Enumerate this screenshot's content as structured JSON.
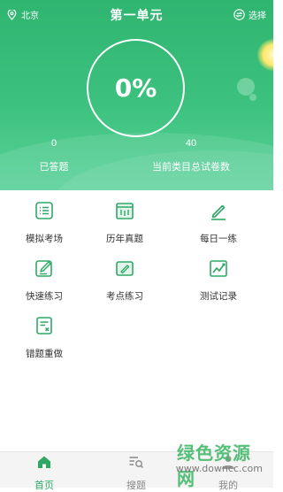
{
  "header": {
    "location": "北京",
    "title": "第一单元",
    "select_label": "选择"
  },
  "progress": {
    "percent_text": "0%",
    "percent_value": 0
  },
  "stats": {
    "answered_value": "0",
    "answered_label": "已答题",
    "total_value": "40",
    "total_label": "当前类目总试卷数"
  },
  "menu": {
    "items": [
      {
        "label": "模拟考场",
        "icon": "list-doc-icon"
      },
      {
        "label": "历年真题",
        "icon": "calendar-book-icon"
      },
      {
        "label": "每日一练",
        "icon": "pencil-icon"
      },
      {
        "label": "快速练习",
        "icon": "edit-box-icon"
      },
      {
        "label": "考点练习",
        "icon": "note-pen-icon"
      },
      {
        "label": "测试记录",
        "icon": "chart-trend-icon"
      },
      {
        "label": "错题重做",
        "icon": "doc-x-icon"
      }
    ]
  },
  "tabs": [
    {
      "label": "首页",
      "icon": "home-icon",
      "active": true
    },
    {
      "label": "搜题",
      "icon": "search-list-icon",
      "active": false
    },
    {
      "label": "我的",
      "icon": "person-icon",
      "active": false
    }
  ],
  "watermark": {
    "cn": "绿色资源网",
    "en": "www.downcc.com"
  },
  "colors": {
    "brand_green": "#2fb570",
    "icon_green": "#2fa866",
    "text_dark": "#333333"
  }
}
